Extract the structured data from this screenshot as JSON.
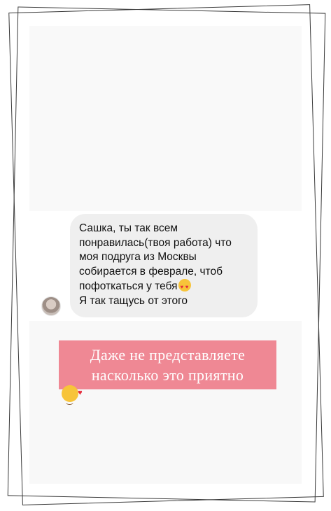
{
  "message": {
    "lines": [
      "Сашка, ты так всем",
      "понравилась(твоя работа) что",
      "моя подруга из Москвы",
      "собирается в феврале, чтоб",
      "пофоткаться у тебя"
    ],
    "last_line": "Я так тащусь от этого",
    "inline_emoji": "heart-eyes-emoji"
  },
  "caption": {
    "line1": "Даже не представляете",
    "line2": "насколько это приятно",
    "emoji": "smiling-face-with-hearts-emoji"
  },
  "colors": {
    "bubble": "#efefef",
    "caption_bg": "#ef8894",
    "card_bg": "#f8f8f8"
  }
}
